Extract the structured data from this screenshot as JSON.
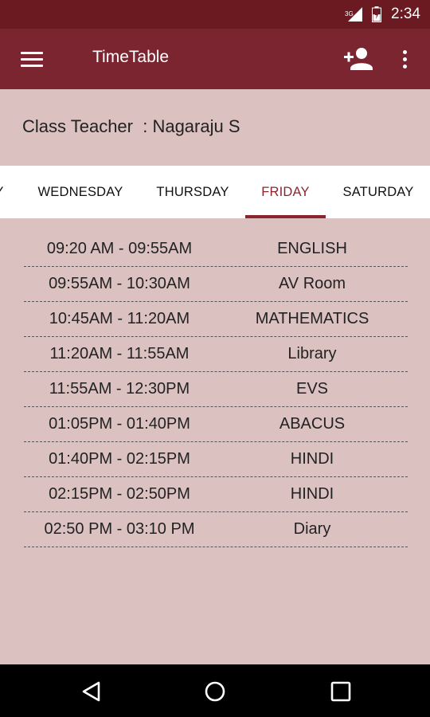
{
  "status_bar": {
    "network_label": "3G",
    "time": "2:34"
  },
  "app_bar": {
    "title": "TimeTable",
    "menu_icon": "hamburger-menu-icon",
    "add_icon": "person-add-icon",
    "more_icon": "more-vert-icon"
  },
  "teacher": {
    "label": "Class Teacher  : Nagaraju S"
  },
  "tabs": [
    {
      "label": "Y"
    },
    {
      "label": "WEDNESDAY"
    },
    {
      "label": "THURSDAY"
    },
    {
      "label": "FRIDAY",
      "active": true
    },
    {
      "label": "SATURDAY"
    }
  ],
  "schedule": [
    {
      "time": "09:20 AM - 09:55AM",
      "subject": "ENGLISH"
    },
    {
      "time": "09:55AM - 10:30AM",
      "subject": "AV Room"
    },
    {
      "time": "10:45AM - 11:20AM",
      "subject": "MATHEMATICS"
    },
    {
      "time": "11:20AM - 11:55AM",
      "subject": "Library"
    },
    {
      "time": "11:55AM - 12:30PM",
      "subject": "EVS"
    },
    {
      "time": "01:05PM - 01:40PM",
      "subject": "ABACUS"
    },
    {
      "time": "01:40PM - 02:15PM",
      "subject": "HINDI"
    },
    {
      "time": "02:15PM - 02:50PM",
      "subject": "HINDI"
    },
    {
      "time": "02:50 PM - 03:10 PM",
      "subject": "Diary"
    }
  ],
  "colors": {
    "app_bar": "#7b2530",
    "status_bar": "#6b1a22",
    "accent": "#8a2530",
    "background": "#dcc1c1"
  },
  "nav": {
    "back_icon": "back-triangle-icon",
    "home_icon": "home-circle-icon",
    "recents_icon": "recents-square-icon"
  }
}
